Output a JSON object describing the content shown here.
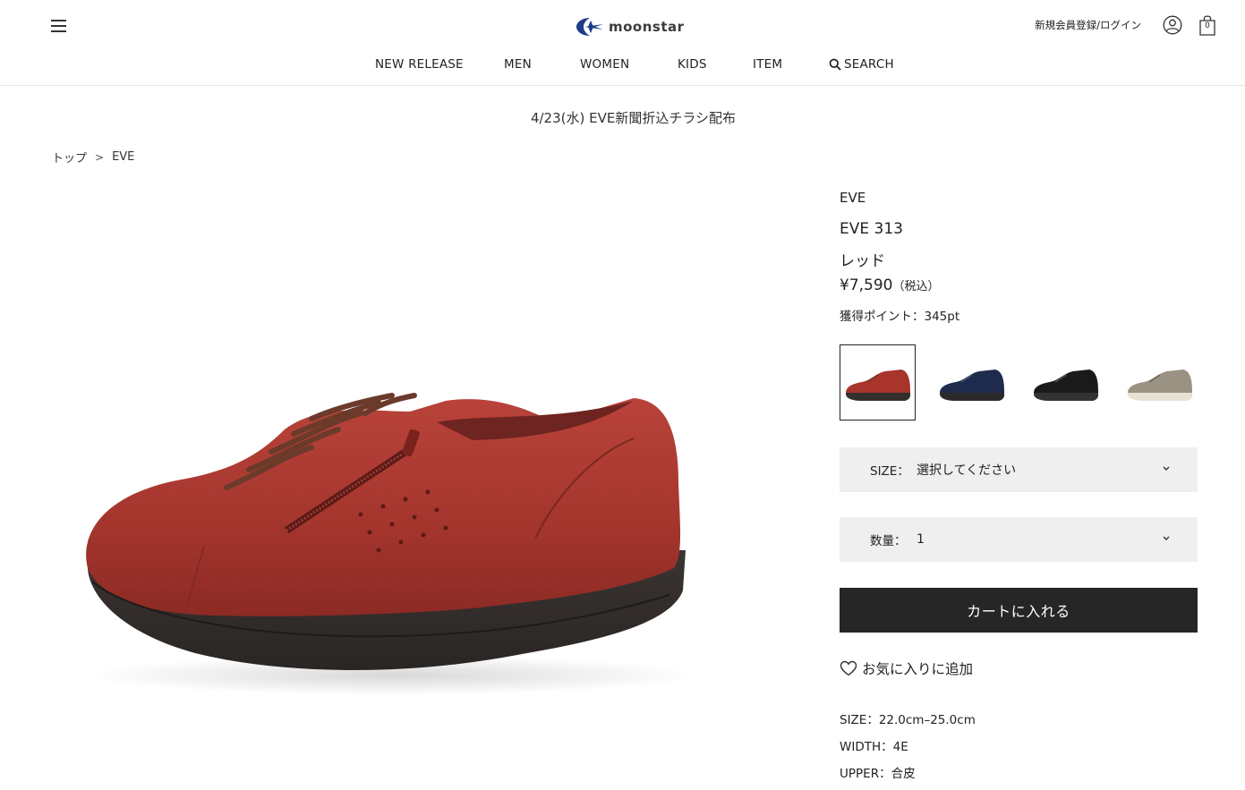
{
  "header": {
    "logo_text": "moonstar",
    "login_link": "新規会員登録/ログイン",
    "cart_count": "0",
    "nav": [
      {
        "label": "NEW RELEASE"
      },
      {
        "label": "MEN"
      },
      {
        "label": "WOMEN"
      },
      {
        "label": "KIDS"
      },
      {
        "label": "ITEM"
      },
      {
        "label": "SEARCH",
        "icon": "search-icon"
      }
    ]
  },
  "announcement": "4/23(水) EVE新聞折込チラシ配布",
  "breadcrumb": {
    "items": [
      "トップ",
      "EVE"
    ],
    "separator": ">"
  },
  "product": {
    "brand": "EVE",
    "name": "EVE 313",
    "color": "レッド",
    "price": "¥7,590",
    "price_tax": "（税込）",
    "points": "獲得ポイント：345pt",
    "swatches": [
      {
        "name": "red",
        "color": "#a8342c",
        "selected": true
      },
      {
        "name": "navy",
        "color": "#1f2b4d",
        "selected": false
      },
      {
        "name": "black",
        "color": "#1a1a1a",
        "selected": false
      },
      {
        "name": "beige",
        "color": "#9a9282",
        "selected": false
      }
    ],
    "size_select": {
      "label": "SIZE：",
      "value": "選択してください"
    },
    "qty_select": {
      "label": "数量：",
      "value": "1"
    },
    "cart_button": "カートに入れる",
    "favorite": "お気に入りに追加",
    "specs": [
      "SIZE：22.0cm–25.0cm",
      "WIDTH：4E",
      "UPPER：合皮"
    ]
  },
  "colors": {
    "accent": "#1e3c8c",
    "button_bg": "#262626",
    "select_bg": "#efefef"
  }
}
